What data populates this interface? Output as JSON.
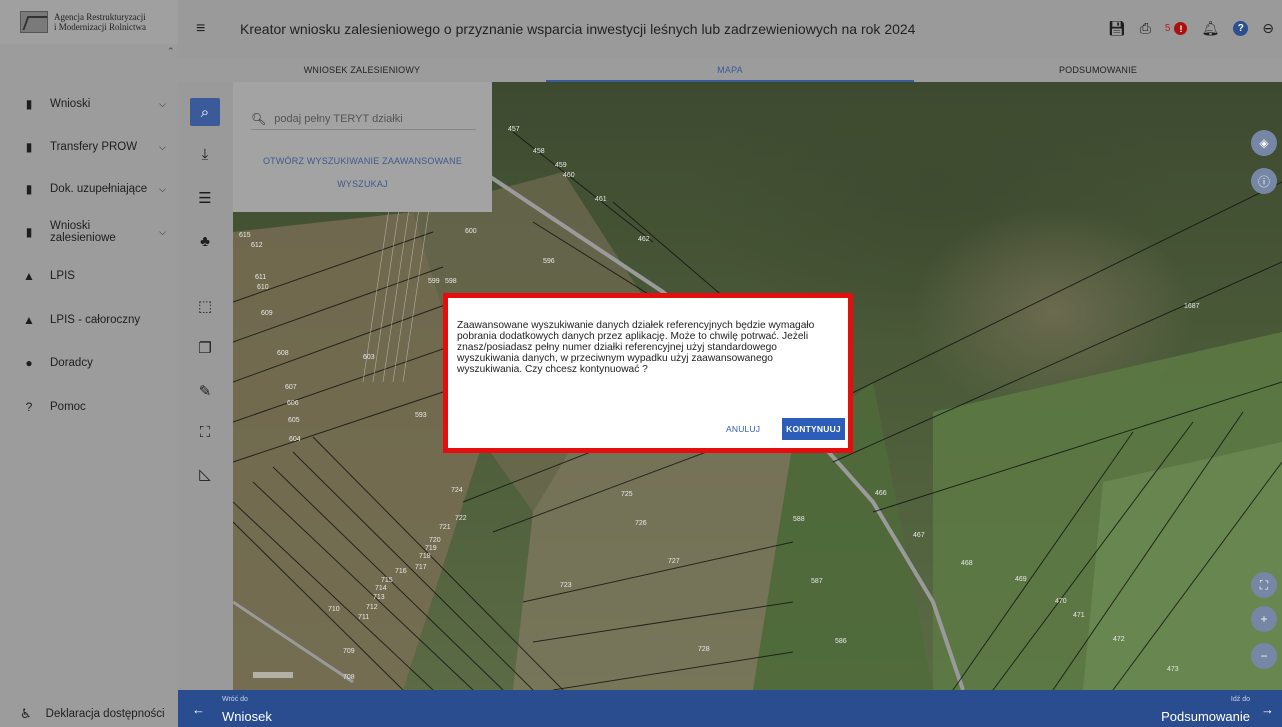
{
  "app": {
    "logo_line1": "Agencja Restrukturyzacji",
    "logo_line2": "i Modernizacji Rolnictwa",
    "title": "Kreator wniosku zalesieniowego o przyznanie wsparcia inwestycji leśnych lub zadrzewieniowych na rok",
    "year": "2024",
    "notification_count": "5",
    "alert_mark": "!"
  },
  "sidebar": {
    "items": [
      {
        "label": "Wnioski",
        "icon": "document-icon",
        "has_chevron": true
      },
      {
        "label": "Transfery PROW",
        "icon": "document-icon",
        "has_chevron": true
      },
      {
        "label": "Dok. uzupełniające",
        "icon": "document-icon",
        "has_chevron": true
      },
      {
        "label": "Wnioski zalesieniowe",
        "icon": "document-icon",
        "has_chevron": true
      },
      {
        "label": "LPIS",
        "icon": "terrain-icon",
        "has_chevron": false
      },
      {
        "label": "LPIS - całoroczny",
        "icon": "terrain-icon",
        "has_chevron": false
      },
      {
        "label": "Doradcy",
        "icon": "person-icon",
        "has_chevron": false
      },
      {
        "label": "Pomoc",
        "icon": "help-icon",
        "has_chevron": false
      }
    ],
    "accessibility_label": "Deklaracja dostępności"
  },
  "tabs": [
    {
      "label": "WNIOSEK ZALESIENIOWY",
      "active": false
    },
    {
      "label": "MAPA",
      "active": true
    },
    {
      "label": "PODSUMOWANIE",
      "active": false
    }
  ],
  "search": {
    "placeholder": "podaj pełny TERYT działki",
    "advanced_link": "OTWÓRZ WYSZUKIWANIE ZAAWANSOWANE",
    "search_button": "WYSZUKAJ"
  },
  "dialog": {
    "message": "Zaawansowane wyszukiwanie danych działek referencyjnych będzie wymagało pobrania dodatkowych danych przez aplikację. Może to chwilę potrwać. Jeżeli znasz/posiadasz pełny numer działki referencyjnej użyj standardowego wyszukiwania danych, w przeciwnym wypadku użyj zaawansowanego wyszukiwania. Czy chcesz kontynuować ?",
    "cancel_label": "ANULUJ",
    "continue_label": "KONTYNUUJ"
  },
  "map": {
    "parcel_labels": [
      "457",
      "458",
      "459",
      "460",
      "461",
      "462",
      "596",
      "600",
      "599",
      "598",
      "615",
      "612",
      "611",
      "610",
      "609",
      "608",
      "607",
      "606",
      "605",
      "604",
      "603",
      "593",
      "724",
      "725",
      "726",
      "727",
      "723",
      "722",
      "721",
      "720",
      "719",
      "718",
      "717",
      "716",
      "715",
      "714",
      "713",
      "712",
      "711",
      "710",
      "709",
      "708",
      "728",
      "586",
      "587",
      "588",
      "466",
      "467",
      "468",
      "469",
      "470",
      "471",
      "472",
      "473",
      "1687"
    ]
  },
  "footer": {
    "back_small": "Wróć do",
    "back_big": "Wniosek",
    "forward_small": "Idź do",
    "forward_big": "Podsumowanie"
  },
  "colors": {
    "primary": "#2a4d8f",
    "dialog_border": "#e60d0d",
    "continue_button": "#2c5db8"
  }
}
